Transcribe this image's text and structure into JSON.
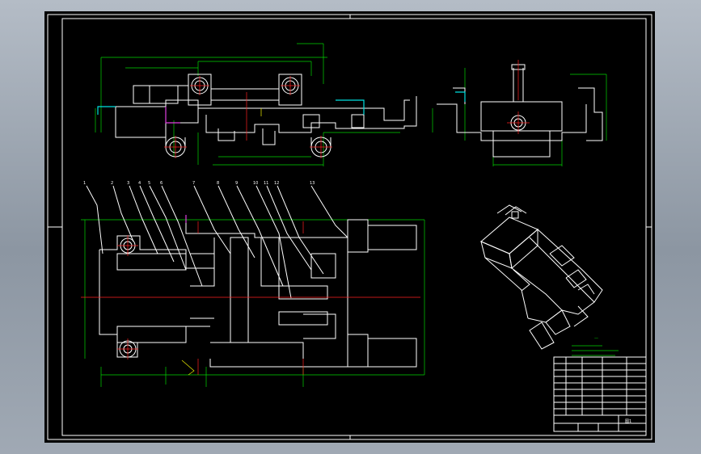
{
  "drawing": {
    "sheet_color": "#000000",
    "outline_color": "#ffffff",
    "dimension_color": "#00d600",
    "centerline_color": "#ff2020",
    "accent_colors": [
      "#00e0e0",
      "#e040e0",
      "#f0f000"
    ]
  },
  "title_block": {
    "label": "图1"
  }
}
